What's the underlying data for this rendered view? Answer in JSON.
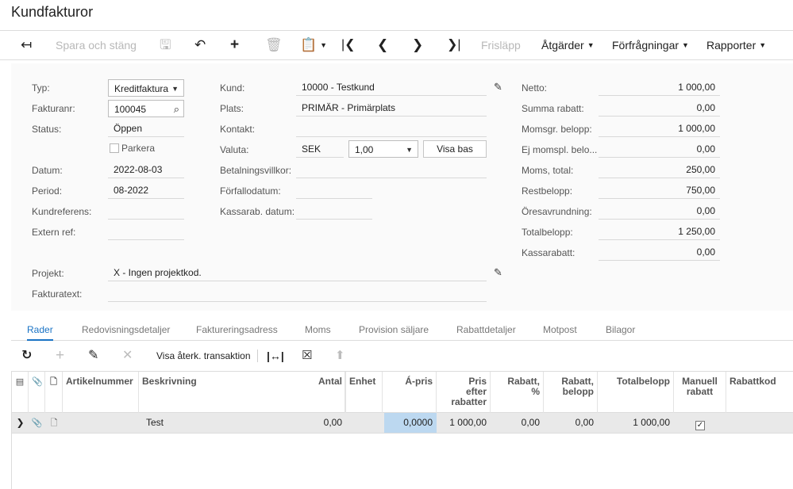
{
  "page": {
    "title": "Kundfakturor"
  },
  "toolbar": {
    "save_close": "Spara och stäng",
    "release": "Frisläpp",
    "actions": "Åtgärder",
    "inquiries": "Förfrågningar",
    "reports": "Rapporter",
    "icons": [
      "back-arrow-icon",
      "save-icon",
      "undo-icon",
      "plus-icon",
      "trash-icon",
      "clipboard-icon",
      "first-icon",
      "prev-icon",
      "next-icon",
      "last-icon"
    ]
  },
  "form": {
    "typ_label": "Typ:",
    "typ_value": "Kreditfaktura",
    "fakturanr_label": "Fakturanr:",
    "fakturanr_value": "100045",
    "status_label": "Status:",
    "status_value": "Öppen",
    "parkera_label": "Parkera",
    "datum_label": "Datum:",
    "datum_value": "2022-08-03",
    "period_label": "Period:",
    "period_value": "08-2022",
    "kundref_label": "Kundreferens:",
    "externref_label": "Extern ref:",
    "kund_label": "Kund:",
    "kund_value": "10000 - Testkund",
    "plats_label": "Plats:",
    "plats_value": "PRIMÄR - Primärplats",
    "kontakt_label": "Kontakt:",
    "valuta_label": "Valuta:",
    "valuta_value": "SEK",
    "kurs_value": "1,00",
    "visa_bas": "Visa bas",
    "betalvillkor_label": "Betalningsvillkor:",
    "forfallo_label": "Förfallodatum:",
    "kassarab_datum_label": "Kassarab. datum:",
    "projekt_label": "Projekt:",
    "projekt_value": "X - Ingen projektkod.",
    "fakturatext_label": "Fakturatext:"
  },
  "summary": [
    {
      "label": "Netto:",
      "value": "1 000,00"
    },
    {
      "label": "Summa rabatt:",
      "value": "0,00"
    },
    {
      "label": "Momsgr. belopp:",
      "value": "1 000,00"
    },
    {
      "label": "Ej momspl. belo...",
      "value": "0,00"
    },
    {
      "label": "Moms, total:",
      "value": "250,00"
    },
    {
      "label": "Restbelopp:",
      "value": "750,00"
    },
    {
      "label": "Öresavrundning:",
      "value": "0,00"
    },
    {
      "label": "Totalbelopp:",
      "value": "1 250,00"
    },
    {
      "label": "Kassarabatt:",
      "value": "0,00"
    }
  ],
  "tabs": [
    "Rader",
    "Redovisningsdetaljer",
    "Faktureringsadress",
    "Moms",
    "Provision säljare",
    "Rabattdetaljer",
    "Motpost",
    "Bilagor"
  ],
  "grid_toolbar": {
    "show_trans": "Visa återk. transaktion"
  },
  "grid": {
    "headers": {
      "artikel": "Artikelnummer",
      "beskrivning": "Beskrivning",
      "antal": "Antal",
      "enhet": "Enhet",
      "apris": "Á-pris",
      "pris_l1": "Pris",
      "pris_l2": "efter",
      "pris_l3": "rabatter",
      "rabpct_l1": "Rabatt,",
      "rabpct_l2": "%",
      "rabbel_l1": "Rabatt,",
      "rabbel_l2": "belopp",
      "total": "Totalbelopp",
      "manuell_l1": "Manuell",
      "manuell_l2": "rabatt",
      "rabattkod": "Rabattkod"
    },
    "row": {
      "beskrivning": "Test",
      "antal": "0,00",
      "apris": "0,0000",
      "pris": "1 000,00",
      "rabpct": "0,00",
      "rabbel": "0,00",
      "total": "1 000,00",
      "manuell_checked": "✓"
    }
  }
}
